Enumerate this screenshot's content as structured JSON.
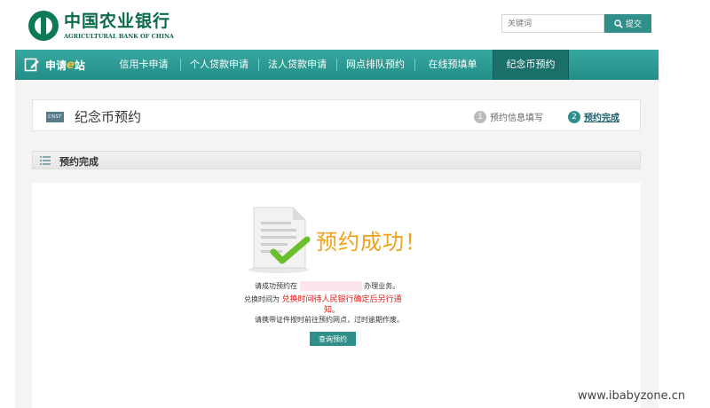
{
  "header": {
    "logo_cn": "中国农业银行",
    "logo_en": "AGRICULTURAL BANK OF CHINA",
    "search_placeholder": "关键词",
    "search_button": "提交"
  },
  "nav": {
    "brand_prefix": "申请",
    "brand_e": "e",
    "brand_suffix": "站",
    "items": [
      {
        "label": "信用卡申请"
      },
      {
        "label": "个人贷款申请"
      },
      {
        "label": "法人贷款申请"
      },
      {
        "label": "网点排队预约"
      },
      {
        "label": "在线预填单"
      },
      {
        "label": "纪念币预约"
      }
    ],
    "active_index": 5
  },
  "title_panel": {
    "badge": "CNST",
    "title": "纪念币预约",
    "steps": [
      {
        "num": "1",
        "label": "预约信息填写"
      },
      {
        "num": "2",
        "label": "预约完成"
      }
    ],
    "current_step": 2
  },
  "section": {
    "title": "预约完成"
  },
  "result": {
    "heading": "预约成功！",
    "line1_prefix": "请成功预约在",
    "line1_suffix": "办理业务。",
    "line2_prefix": "兑换时间为",
    "line2_red": "兑换时间待人民银行确定后另行通",
    "line3_red": "知",
    "line3_suffix": "。",
    "line4": "请携带证件按时前往预约网点，过时逾期作废。",
    "query_button": "查询预约"
  },
  "watermark": "www.ibabyzone.cn",
  "colors": {
    "brand_green": "#0b6a4a",
    "nav_teal": "#2f9c95",
    "nav_active": "#1a6f6a",
    "success_orange": "#f0a21c",
    "alert_red": "#e02020"
  }
}
